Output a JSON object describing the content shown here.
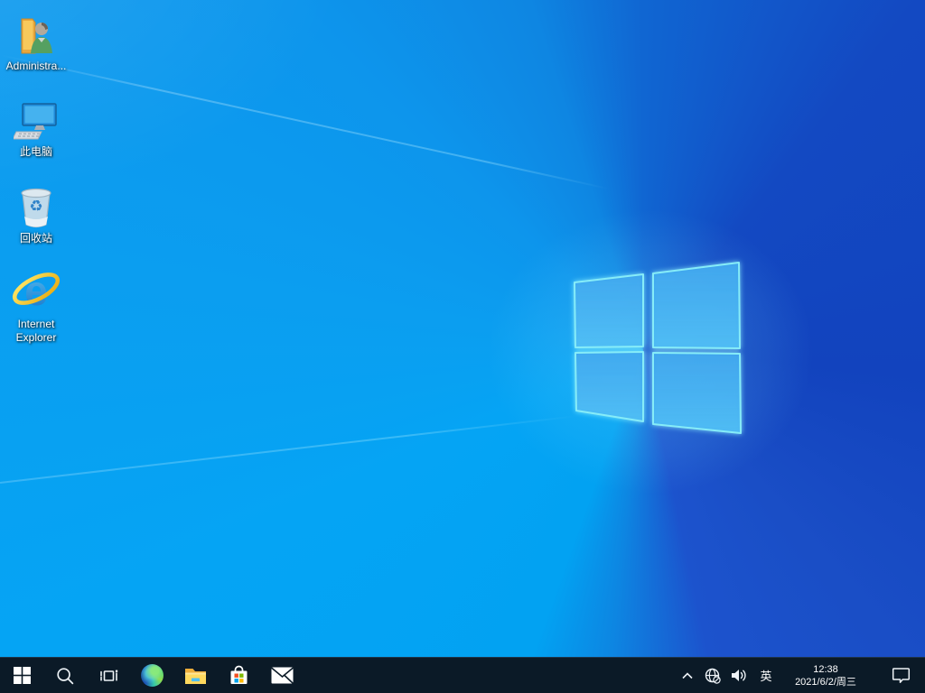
{
  "desktop": {
    "icons": [
      {
        "id": "administrator",
        "label": "Administra..."
      },
      {
        "id": "this-pc",
        "label": "此电脑"
      },
      {
        "id": "recycle-bin",
        "label": "回收站"
      },
      {
        "id": "internet-explorer",
        "label": "Internet Explorer"
      }
    ],
    "glyphs": {
      "recycle": "♻",
      "ie_e": "e"
    }
  },
  "taskbar": {
    "buttons": [
      {
        "id": "start",
        "icon": "windows-logo"
      },
      {
        "id": "search",
        "icon": "magnifier"
      },
      {
        "id": "task-view",
        "icon": "task-view-frames"
      },
      {
        "id": "edge",
        "icon": "edge-swirl"
      },
      {
        "id": "file-explorer",
        "icon": "yellow-folder"
      },
      {
        "id": "store",
        "icon": "store-bag"
      },
      {
        "id": "mail",
        "icon": "envelope"
      }
    ],
    "tray": {
      "hidden_icons": "chevron-up",
      "network": "globe-no-internet",
      "volume": "speaker-waves",
      "language_indicator": "英",
      "clock": {
        "time": "12:38",
        "date": "2021/6/2/周三"
      },
      "action_center": "notification-bubble"
    }
  },
  "colors": {
    "wallpaper_azure": "#02a2f2",
    "wallpaper_royal": "#1243be",
    "logo_edge_glow": "#86ecf8",
    "taskbar_bg": "#0b1a27",
    "store_red": "#f25022",
    "store_green": "#7fba00",
    "store_blue": "#00a4ef",
    "store_yellow": "#ffb900",
    "folder_gold": "#ffd95e",
    "ie_blue": "#2e9fe6",
    "ie_gold": "#f6c432"
  }
}
